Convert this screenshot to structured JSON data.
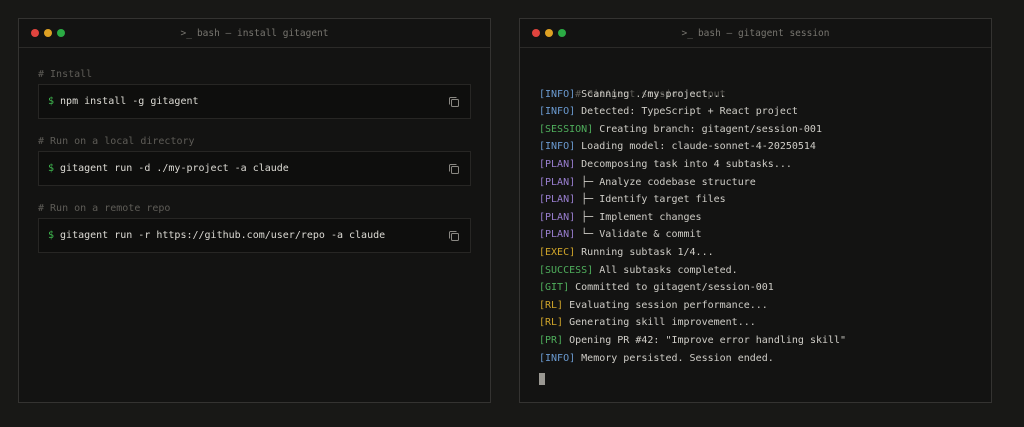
{
  "windows": {
    "left": {
      "title": "bash — install gitagent",
      "prompt_symbol": "$",
      "blocks": [
        {
          "comment": "# Install",
          "command": "npm install -g gitagent"
        },
        {
          "comment": "# Run on a local directory",
          "command": "gitagent run -d ./my-project -a claude"
        },
        {
          "comment": "# Run on a remote repo",
          "command": "gitagent run -r https://github.com/user/repo -a claude"
        }
      ]
    },
    "right": {
      "title": "bash — gitagent session",
      "header": "# GitAgent session output",
      "lines": [
        {
          "tag": "[INFO]",
          "msg": "Scanning ./my-project...",
          "color": "#6b9bd1"
        },
        {
          "tag": "[INFO]",
          "msg": "Detected: TypeScript + React project",
          "color": "#6b9bd1"
        },
        {
          "tag": "[SESSION]",
          "msg": "Creating branch: gitagent/session-001",
          "color": "#4fae5c"
        },
        {
          "tag": "[INFO]",
          "msg": "Loading model: claude-sonnet-4-20250514",
          "color": "#6b9bd1"
        },
        {
          "tag": "[PLAN]",
          "msg": "Decomposing task into 4 subtasks...",
          "color": "#9a7fd1"
        },
        {
          "tag": "[PLAN]",
          "msg": "├─ Analyze codebase structure",
          "color": "#9a7fd1"
        },
        {
          "tag": "[PLAN]",
          "msg": "├─ Identify target files",
          "color": "#9a7fd1"
        },
        {
          "tag": "[PLAN]",
          "msg": "├─ Implement changes",
          "color": "#9a7fd1"
        },
        {
          "tag": "[PLAN]",
          "msg": "└─ Validate & commit",
          "color": "#9a7fd1"
        },
        {
          "tag": "[EXEC]",
          "msg": "Running subtask 1/4...",
          "color": "#d0a52a"
        },
        {
          "tag": "[SUCCESS]",
          "msg": "All subtasks completed.",
          "color": "#4fae5c"
        },
        {
          "tag": "[GIT]",
          "msg": "Committed to gitagent/session-001",
          "color": "#4fae5c"
        },
        {
          "tag": "[RL]",
          "msg": "Evaluating session performance...",
          "color": "#d0a52a"
        },
        {
          "tag": "[RL]",
          "msg": "Generating skill improvement...",
          "color": "#d0a52a"
        },
        {
          "tag": "[PR]",
          "msg": "Opening PR #42: \"Improve error handling skill\"",
          "color": "#4fae5c"
        },
        {
          "tag": "[INFO]",
          "msg": "Memory persisted. Session ended.",
          "color": "#6b9bd1"
        }
      ]
    }
  },
  "icons": {
    "terminal": "terminal-prompt-icon",
    "copy": "copy-icon"
  }
}
